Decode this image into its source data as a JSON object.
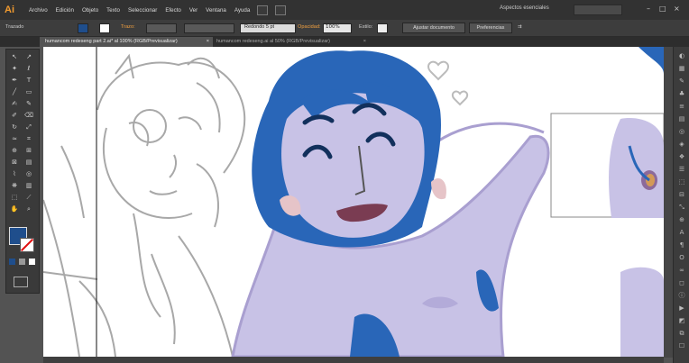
{
  "app": {
    "logo": "Ai",
    "accent": "#f29b2f"
  },
  "menubar": {
    "items": [
      "Archivo",
      "Edición",
      "Objeto",
      "Texto",
      "Seleccionar",
      "Efecto",
      "Ver",
      "Ventana",
      "Ayuda"
    ],
    "workspace": "Aspectos esenciales"
  },
  "controlbar": {
    "selection_label": "Trazado",
    "stroke_label": "Trazo:",
    "brush_label": "Redondo 5 pt",
    "opacity_label": "Opacidad:",
    "opacity_value": "100%",
    "style_label": "Estilo:",
    "doc_setup_button": "Ajustar documento",
    "prefs_button": "Preferencias",
    "first_label": "Trazado"
  },
  "tabs": [
    {
      "label": "humancom redeseng part 2.ai* al 100% (RGB/Previsualizar)",
      "close": "×"
    },
    {
      "label": "humancom redeseng.ai al 50% (RGB/Previsualizar)",
      "close": "×"
    }
  ],
  "colors": {
    "fill": "#1f4e8c",
    "hair": "#2966b8",
    "skin": "#c8c2e6",
    "skin_shadow": "#a99fd0"
  },
  "tools": [
    "selection-tool",
    "direct-selection-tool",
    "magic-wand-tool",
    "lasso-tool",
    "pen-tool",
    "type-tool",
    "line-tool",
    "rectangle-tool",
    "paintbrush-tool",
    "pencil-tool",
    "blob-brush-tool",
    "eraser-tool",
    "rotate-tool",
    "scale-tool",
    "width-tool",
    "free-transform-tool",
    "shape-builder-tool",
    "perspective-tool",
    "mesh-tool",
    "gradient-tool",
    "eyedropper-tool",
    "blend-tool",
    "symbol-sprayer-tool",
    "graph-tool",
    "artboard-tool",
    "slice-tool",
    "hand-tool",
    "zoom-tool"
  ]
}
